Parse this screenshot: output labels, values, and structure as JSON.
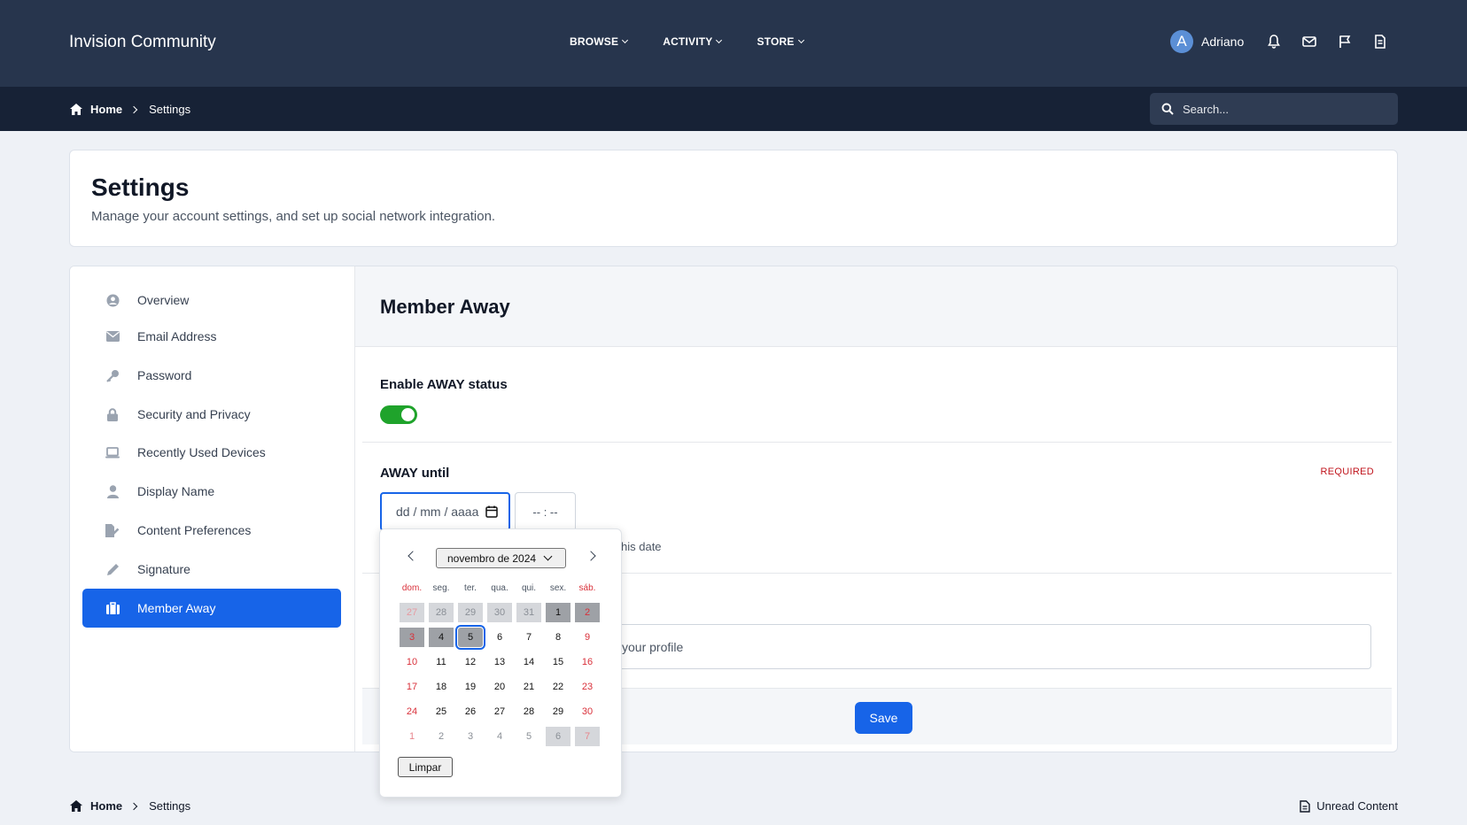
{
  "header": {
    "brand": "Invision Community",
    "nav": [
      {
        "label": "BROWSE"
      },
      {
        "label": "ACTIVITY"
      },
      {
        "label": "STORE"
      }
    ],
    "user": {
      "initial": "A",
      "name": "Adriano"
    },
    "icons": [
      "bell-icon",
      "envelope-icon",
      "flag-icon",
      "document-icon"
    ]
  },
  "breadcrumb": {
    "home": "Home",
    "current": "Settings"
  },
  "search": {
    "placeholder": "Search..."
  },
  "page": {
    "title": "Settings",
    "subtitle": "Manage your account settings, and set up social network integration."
  },
  "sidebar": {
    "items": [
      {
        "label": "Overview",
        "icon": "user-circle-icon"
      },
      {
        "label": "Email Address",
        "icon": "envelope-icon"
      },
      {
        "label": "Password",
        "icon": "key-icon"
      },
      {
        "label": "Security and Privacy",
        "icon": "lock-icon"
      },
      {
        "label": "Recently Used Devices",
        "icon": "laptop-icon"
      },
      {
        "label": "Display Name",
        "icon": "user-icon"
      },
      {
        "label": "Content Preferences",
        "icon": "file-pen-icon"
      },
      {
        "label": "Signature",
        "icon": "pencil-icon"
      },
      {
        "label": "Member Away",
        "icon": "briefcase-icon",
        "active": true
      }
    ]
  },
  "form": {
    "section_title": "Member Away",
    "enable_label": "Enable AWAY status",
    "enable_value": true,
    "until_label": "AWAY until",
    "required": "REQUIRED",
    "date_placeholder": "dd / mm / aaaa",
    "time_placeholder": "-- : --",
    "hint_partial": "his date",
    "message_partial": "your profile",
    "save_label": "Save"
  },
  "datepicker": {
    "month": "novembro de 2024",
    "weekdays": [
      "dom.",
      "seg.",
      "ter.",
      "qua.",
      "qui.",
      "sex.",
      "sáb."
    ],
    "weeks": [
      [
        "27",
        "28",
        "29",
        "30",
        "31",
        "1",
        "2"
      ],
      [
        "3",
        "4",
        "5",
        "6",
        "7",
        "8",
        "9"
      ],
      [
        "10",
        "11",
        "12",
        "13",
        "14",
        "15",
        "16"
      ],
      [
        "17",
        "18",
        "19",
        "20",
        "21",
        "22",
        "23"
      ],
      [
        "24",
        "25",
        "26",
        "27",
        "28",
        "29",
        "30"
      ],
      [
        "1",
        "2",
        "3",
        "4",
        "5",
        "6",
        "7"
      ]
    ],
    "selected_day": "5",
    "clear_label": "Limpar"
  },
  "footer": {
    "unread": "Unread Content"
  }
}
